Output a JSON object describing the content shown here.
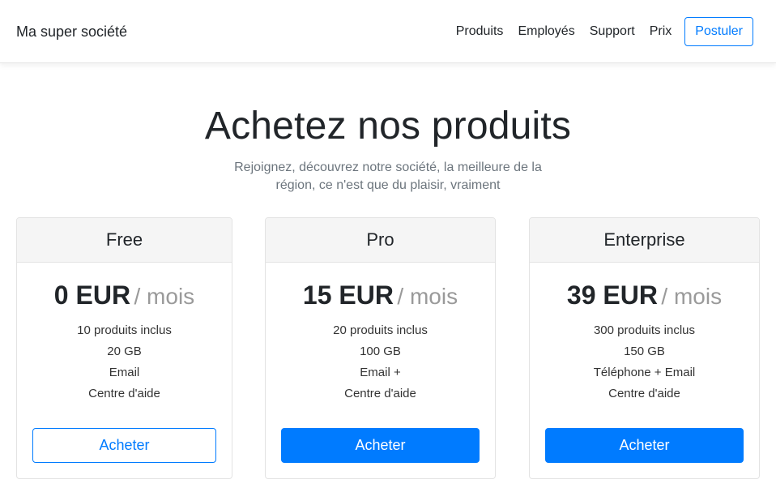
{
  "navbar": {
    "brand": "Ma super société",
    "links": [
      "Produits",
      "Employés",
      "Support",
      "Prix"
    ],
    "apply_label": "Postuler",
    "accent_color": "#007bff"
  },
  "hero": {
    "title": "Achetez nos produits",
    "subtitle_line1": "Rejoignez, découvrez notre société, la meilleure de la",
    "subtitle_line2": "région, ce n'est que du plaisir, vraiment"
  },
  "plans": [
    {
      "name": "Free",
      "price": "0 EUR",
      "period": "/ mois",
      "features": [
        "10 produits inclus",
        "20 GB",
        "Email",
        "Centre d'aide"
      ],
      "button_label": "Acheter",
      "button_style": "outline"
    },
    {
      "name": "Pro",
      "price": "15 EUR",
      "period": "/ mois",
      "features": [
        "20 produits inclus",
        "100 GB",
        "Email +",
        "Centre d'aide"
      ],
      "button_label": "Acheter",
      "button_style": "solid"
    },
    {
      "name": "Enterprise",
      "price": "39 EUR",
      "period": "/ mois",
      "features": [
        "300 produits inclus",
        "150 GB",
        "Téléphone + Email",
        "Centre d'aide"
      ],
      "button_label": "Acheter",
      "button_style": "solid"
    }
  ]
}
